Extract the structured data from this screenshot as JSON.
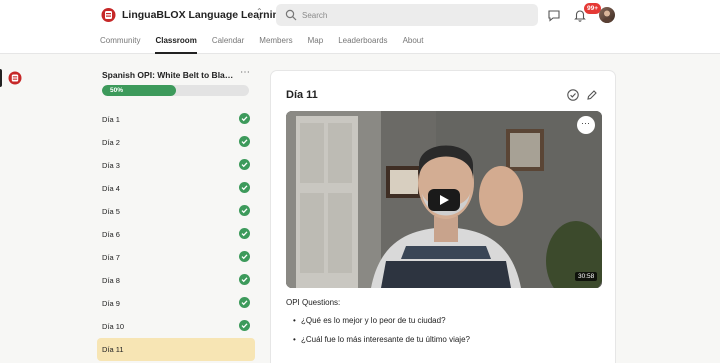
{
  "header": {
    "brand": "LinguaBLOX Language Learning",
    "search_placeholder": "Search",
    "notification_badge": "99+",
    "tabs": [
      {
        "label": "Community",
        "active": false
      },
      {
        "label": "Classroom",
        "active": true
      },
      {
        "label": "Calendar",
        "active": false
      },
      {
        "label": "Members",
        "active": false
      },
      {
        "label": "Map",
        "active": false
      },
      {
        "label": "Leaderboards",
        "active": false
      },
      {
        "label": "About",
        "active": false
      }
    ]
  },
  "course": {
    "title": "Spanish OPI: White Belt to Black ...",
    "progress_label": "50%",
    "progress_fraction": 0.5,
    "lessons": [
      {
        "label": "Día 1",
        "completed": true,
        "active": false
      },
      {
        "label": "Día 2",
        "completed": true,
        "active": false
      },
      {
        "label": "Día 3",
        "completed": true,
        "active": false
      },
      {
        "label": "Día 4",
        "completed": true,
        "active": false
      },
      {
        "label": "Día 5",
        "completed": true,
        "active": false
      },
      {
        "label": "Día 6",
        "completed": true,
        "active": false
      },
      {
        "label": "Día 7",
        "completed": true,
        "active": false
      },
      {
        "label": "Día 8",
        "completed": true,
        "active": false
      },
      {
        "label": "Día 9",
        "completed": true,
        "active": false
      },
      {
        "label": "Día 10",
        "completed": true,
        "active": false
      },
      {
        "label": "Día 11",
        "completed": false,
        "active": true
      }
    ]
  },
  "lesson": {
    "title": "Día 11",
    "video_duration": "30:58",
    "questions_heading": "OPI Questions:",
    "questions": [
      "¿Qué es lo mejor y lo peor de tu ciudad?",
      "¿Cuál fue lo más interesante de tu último viaje?"
    ]
  },
  "colors": {
    "accent_green": "#3d9a5b",
    "active_lesson": "#f7e5b4",
    "badge_red": "#e53935"
  }
}
